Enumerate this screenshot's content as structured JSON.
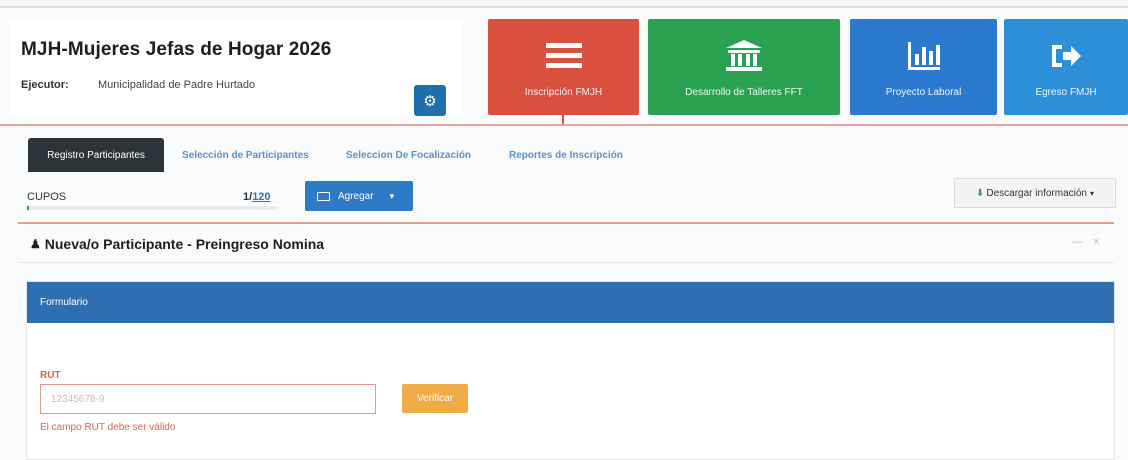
{
  "header": {
    "title": "MJH-Mujeres Jefas de Hogar 2026",
    "executor_label": "Ejecutor:",
    "executor_value": "Municipalidad de Padre Hurtado"
  },
  "tiles": [
    {
      "label": "Inscripción FMJH",
      "icon": "list-icon",
      "color": "#d9503e"
    },
    {
      "label": "Desarrollo de Talleres FFT",
      "icon": "institution-icon",
      "color": "#2aa150"
    },
    {
      "label": "Proyecto Laboral",
      "icon": "bar-chart-icon",
      "color": "#2b7ad0"
    },
    {
      "label": "Egreso FMJH",
      "icon": "sign-out-icon",
      "color": "#2c8fd8"
    }
  ],
  "tabs": [
    {
      "label": "Registro Participantes",
      "active": true
    },
    {
      "label": "Selección de Participantes",
      "active": false
    },
    {
      "label": "Seleccion De Focalización",
      "active": false
    },
    {
      "label": "Reportes de Inscripción",
      "active": false
    }
  ],
  "cupos": {
    "label": "CUPOS",
    "current": "1/",
    "total": "120",
    "progress_fraction": 0.008
  },
  "toolbar": {
    "add_label": "Agregar",
    "download_label": "Descargar información"
  },
  "section": {
    "title": "Nueva/o Participante - Preingreso Nomina"
  },
  "form": {
    "header": "Formulario",
    "rut_label": "RUT",
    "rut_placeholder": "12345678-9",
    "verify_label": "Verificar",
    "rut_error": "El campo RUT debe ser válido"
  },
  "colors": {
    "accent_blue": "#2d6fb2",
    "danger": "#d9503e",
    "success": "#2aa150",
    "warning": "#f0ac46"
  }
}
